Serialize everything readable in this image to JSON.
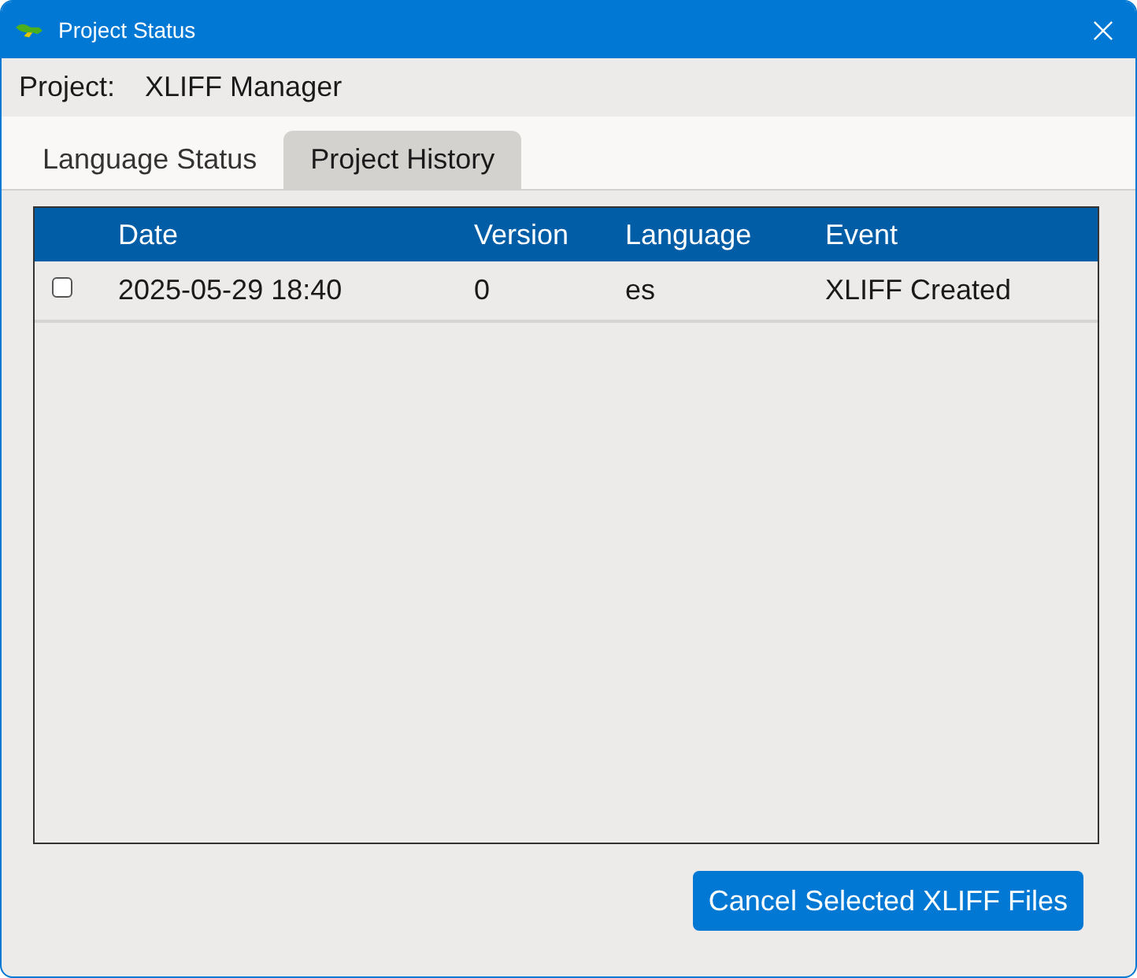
{
  "window": {
    "title": "Project Status"
  },
  "project": {
    "label": "Project:",
    "value": "XLIFF Manager"
  },
  "tabs": [
    {
      "label": "Language Status",
      "selected": false
    },
    {
      "label": "Project History",
      "selected": true
    }
  ],
  "table": {
    "columns": [
      "Date",
      "Version",
      "Language",
      "Event"
    ],
    "rows": [
      {
        "checked": false,
        "cells": [
          "2025-05-29 18:40",
          "0",
          "es",
          "XLIFF Created"
        ]
      }
    ]
  },
  "buttons": [
    {
      "label": "Cancel Selected XLIFF Files"
    }
  ]
}
